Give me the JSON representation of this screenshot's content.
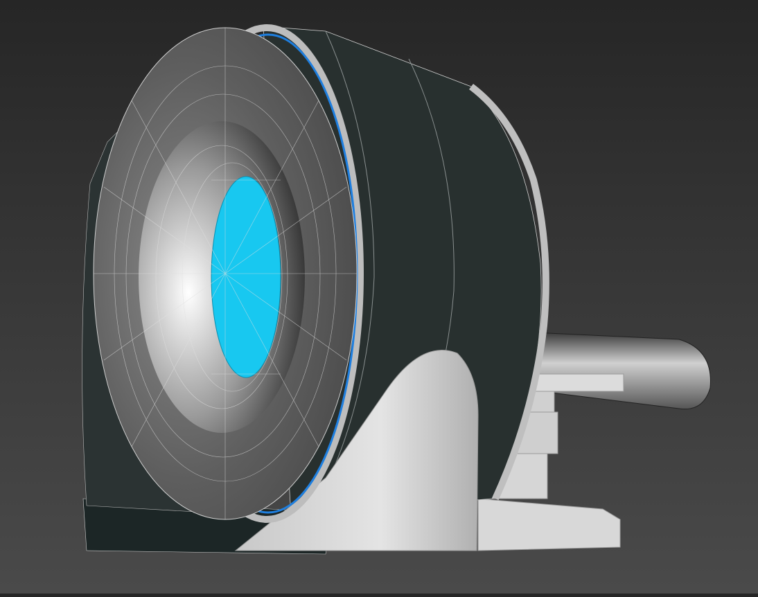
{
  "viewport": {
    "subject": "ct-scanner-3d-model",
    "colors": {
      "background_top": "#262626",
      "background_bottom": "#4a4a4a",
      "housing_front": "#6b6b6b",
      "housing_body": "#28302f",
      "bore": "#18c8f0",
      "accent_ring": "#1e7fe0",
      "pedestal": "#d8d8d8",
      "wire": "#e0e0e0"
    }
  }
}
